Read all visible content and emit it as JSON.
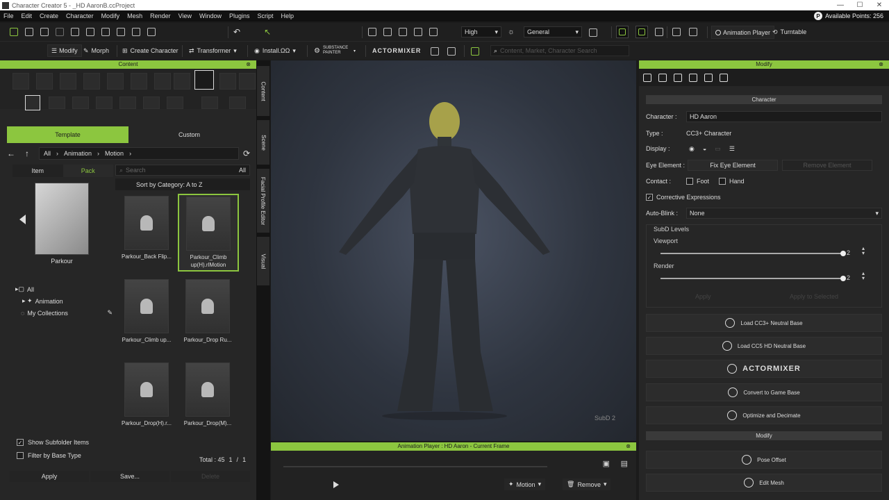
{
  "titlebar": {
    "title": "Character Creator 5 - _HD AaronB.ccProject",
    "min": "—",
    "max": "☐",
    "close": "✕"
  },
  "menu": {
    "items": [
      "File",
      "Edit",
      "Create",
      "Character",
      "Modify",
      "Mesh",
      "Render",
      "View",
      "Window",
      "Plugins",
      "Script",
      "Help"
    ],
    "points_icon": "P",
    "points_label": "Available Points: 256"
  },
  "toolbar1": {
    "quality": "High",
    "preset": "General",
    "animation_player": "Animation Player",
    "turntable": "Turntable"
  },
  "toolbar2": {
    "modify": "Modify",
    "morph": "Morph",
    "create_character": "Create Character",
    "transformer": "Transformer",
    "install": "Install.ΩΩ",
    "substance": "SUBSTANCE PAINTER",
    "actormixer": "ACTORMIXER",
    "search_placeholder": "Content, Market, Character Search"
  },
  "content": {
    "header": "Content",
    "tabs": {
      "template": "Template",
      "custom": "Custom"
    },
    "breadcrumb": {
      "all": "All",
      "animation": "Animation",
      "motion": "Motion"
    },
    "subtabs": {
      "item": "Item",
      "pack": "Pack"
    },
    "search_placeholder": "Search",
    "filter_all": "All",
    "sort": "Sort by Category: A to Z",
    "pack_label": "Parkour",
    "tree": {
      "all": "All",
      "animation": "Animation",
      "collections": "My Collections"
    },
    "items": [
      "Parkour_Back Flip...",
      "Parkour_Climb up(H).rlMotion",
      "Parkour_Climb up...",
      "Parkour_Drop Ru...",
      "Parkour_Drop(H).r...",
      "Parkour_Drop(M)..."
    ],
    "show_subfolder": "Show Subfolder Items",
    "filter_base": "Filter by Base Type",
    "total": "Total : 45",
    "page": "1",
    "page_sep": "/",
    "page_total": "1",
    "apply": "Apply",
    "save": "Save...",
    "delete": "Delete"
  },
  "vtabs": {
    "content": "Content",
    "scene": "Scene",
    "facial": "Facial Profile Editor",
    "visual": "Visual"
  },
  "viewport": {
    "subd": "SubD 2"
  },
  "anim": {
    "header": "Animation Player : HD Aaron - Current Frame",
    "motion": "Motion",
    "remove": "Remove"
  },
  "modify": {
    "header": "Modify",
    "section_character": "Character",
    "character_label": "Character :",
    "character_value": "HD Aaron",
    "type_label": "Type :",
    "type_value": "CC3+ Character",
    "display_label": "Display :",
    "eye_label": "Eye Element :",
    "eye_fix": "Fix Eye Element",
    "eye_remove": "Remove Element",
    "contact_label": "Contact :",
    "foot": "Foot",
    "hand": "Hand",
    "corrective": "Corrective Expressions",
    "autoblink_label": "Auto-Blink :",
    "autoblink_value": "None",
    "subd_label": "SubD Levels",
    "viewport_label": "Viewport",
    "viewport_value": "2",
    "render_label": "Render",
    "render_value": "2",
    "apply": "Apply",
    "apply_to_all": "Apply to Selected",
    "load_cc3": "Load CC3+ Neutral Base",
    "load_cc5": "Load CC5 HD Neutral Base",
    "actormixer": "ACTORMIXER",
    "convert": "Convert to Game Base",
    "optimize": "Optimize and Decimate",
    "section_modify": "Modify",
    "pose_offset": "Pose Offset",
    "edit_mesh": "Edit Mesh"
  },
  "colors": {
    "accent": "#8cc63f",
    "panel": "#262626",
    "bg": "#1b1b1b"
  }
}
